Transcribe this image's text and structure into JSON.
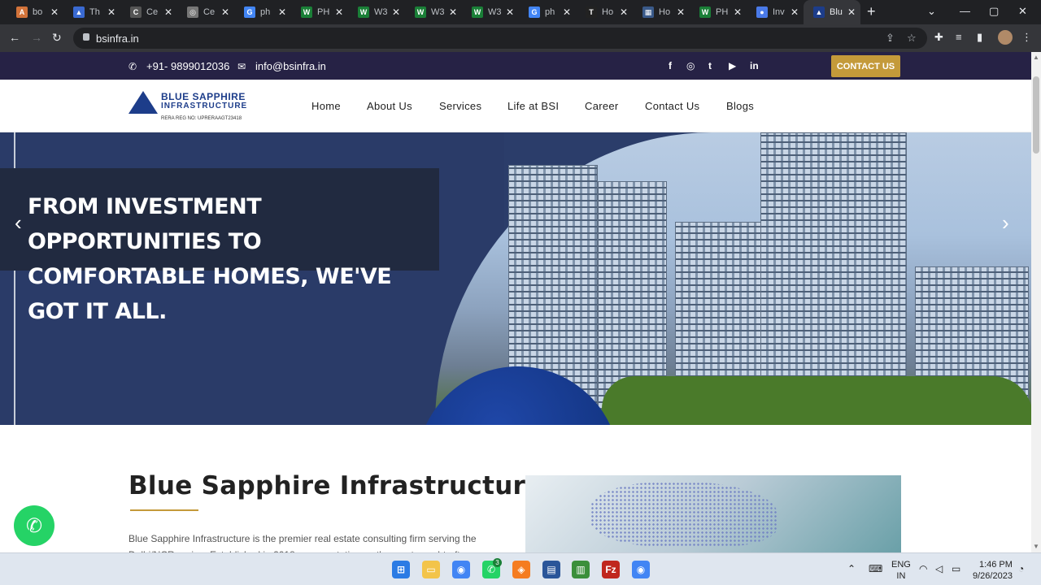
{
  "browser": {
    "tabs": [
      {
        "title": "bo",
        "color": "#d2733a",
        "glyph": "A"
      },
      {
        "title": "Th",
        "color": "#3a6ad2",
        "glyph": "▲"
      },
      {
        "title": "Ce",
        "color": "#555555",
        "glyph": "C"
      },
      {
        "title": "Ce",
        "color": "#777777",
        "glyph": "◎"
      },
      {
        "title": "ph",
        "color": "#4285f4",
        "glyph": "G"
      },
      {
        "title": "PH",
        "color": "#1a7f37",
        "glyph": "W"
      },
      {
        "title": "W3",
        "color": "#1a7f37",
        "glyph": "W"
      },
      {
        "title": "W3",
        "color": "#1a7f37",
        "glyph": "W"
      },
      {
        "title": "W3",
        "color": "#1a7f37",
        "glyph": "W"
      },
      {
        "title": "ph",
        "color": "#4285f4",
        "glyph": "G"
      },
      {
        "title": "Ho",
        "color": "#222222",
        "glyph": "T"
      },
      {
        "title": "Ho",
        "color": "#3a5a8a",
        "glyph": "▦"
      },
      {
        "title": "PH",
        "color": "#1a7f37",
        "glyph": "W"
      },
      {
        "title": "Inv",
        "color": "#4a7ae8",
        "glyph": "●"
      },
      {
        "title": "Blu",
        "color": "#1d3d8a",
        "glyph": "▲"
      }
    ],
    "url": "bsinfra.in"
  },
  "topbar": {
    "phone": "+91- 9899012036",
    "email": "info@bsinfra.in",
    "social": [
      "f",
      "◎",
      "t",
      "▶",
      "in"
    ],
    "contact_button": "CONTACT US"
  },
  "logo": {
    "name": "BLUE SAPPHIRE",
    "sub": "INFRASTRUCTURE",
    "rera": "RERA REG NO: UPRERAAGT23418"
  },
  "nav": [
    "Home",
    "About Us",
    "Services",
    "Life at BSI",
    "Career",
    "Contact Us",
    "Blogs"
  ],
  "hero": {
    "headline": "FROM INVESTMENT OPPORTUNITIES TO COMFORTABLE HOMES, WE'VE GOT IT ALL."
  },
  "about": {
    "title": "Blue Sapphire Infrastructure",
    "paragraph": "Blue Sapphire Infrastructure is the premier real estate consulting firm serving the Delhi/NCR region. Established in 2018, our reputation as the most sought-after"
  },
  "taskbar": {
    "lang_top": "ENG",
    "lang_bottom": "IN",
    "time": "1:46 PM",
    "date": "9/26/2023",
    "whatsapp_badge": "3"
  }
}
